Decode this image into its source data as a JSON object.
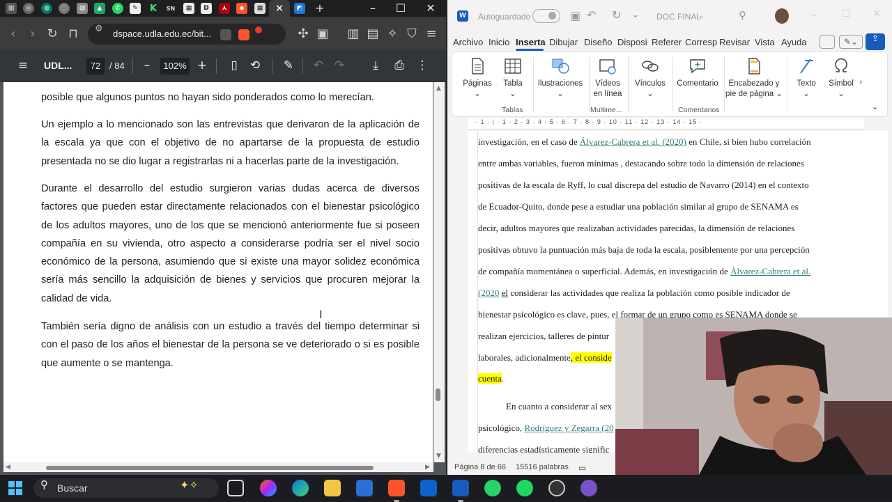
{
  "browser": {
    "address": "dspace.udla.edu.ec/bit...",
    "pdf_title": "UDL...",
    "page_current": "72",
    "page_total": "/ 84",
    "zoom": "102%",
    "paragraphs": [
      "posible que algunos puntos no hayan sido ponderados como lo merecían.",
      "Un ejemplo a lo mencionado son las entrevistas que derivaron de la aplicación de la escala ya que con el objetivo de no apartarse de la propuesta de estudio presentada no se dio lugar a registrarlas ni a hacerlas parte de la investigación.",
      "Durante el desarrollo del estudio surgieron varias dudas acerca de diversos factores que pueden estar directamente relacionados con el bienestar psicológico de los adultos mayores, uno de los que se mencionó anteriormente fue si poseen compañía en su vivienda, otro aspecto a considerarse podría ser el nivel socio económico de la persona, asumiendo que si existe una mayor solidez económica sería más sencillo la adquisición de bienes y servicios que procuren mejorar la calidad de vida.",
      "También sería digno de análisis con un estudio a través del tiempo determinar si con el paso de los años el bienestar de la persona se ve deteriorado o si es posible que aumente o se mantenga."
    ]
  },
  "word": {
    "autosave_label": "Autoguardado",
    "doc_title": "DOC FINAL",
    "tabs": [
      "Archivo",
      "Inicio",
      "Inserta",
      "Dibujar",
      "Diseño",
      "Disposi",
      "Referer",
      "Corresp",
      "Revisar",
      "Vista",
      "Ayuda"
    ],
    "ribbon": {
      "paginas": "Páginas",
      "tabla": "Tabla",
      "ilustraciones": "Ilustraciones",
      "videos_1": "Vídeos",
      "videos_2": "en línea",
      "vinculos": "Vínculos",
      "comentario": "Comentario",
      "encabezado_1": "Encabezado y",
      "encabezado_2": "pie de página",
      "texto": "Texto",
      "simbolos": "Símbol",
      "group_tablas": "Tablas",
      "group_multimedia": "Multime...",
      "group_comentarios": "Comentarios"
    },
    "ruler": "· 1 · | · 1 · 2 · 3 · 4 · 5 · 6 · 7 · 8 · 9 · 10 · 11 · 12 · 13 · 14 · 15 ·",
    "doc": {
      "l1_a": "investigación, en el caso de ",
      "l1_cite": "Álvarez-Cabrera et al. (2020)",
      "l1_b": " en Chile, si bien hubo correlación",
      "l2": "entre ambas variables, fueron mínimas , destacando sobre todo la dimensión de relaciones",
      "l3": "positivas de la escala de Ryff, lo cual discrepa del estudio de Navarro (2014) en el contexto",
      "l4": "de Ecuador-Quito, donde pese a estudiar una población similar al grupo de SENAMA es",
      "l5": "decir, adultos mayores que realizaban actividades parecidas, la dimensión de relaciones",
      "l6": "positivas obtuvo la puntuación más baja de toda la escala, posiblemente por una percepción",
      "l7_a": "de compañía momentánea o superficial. Además, en investigación de ",
      "l7_cite": "Álvarez-Cabrera et al.",
      "l8_cite": "(2020",
      "l8_el": "el",
      "l8_b": " considerar las actividades que realiza la población como posible indicador de",
      "l9": "bienestar psicológico es clave, pues, el formar de un grupo como es SENAMA donde se",
      "l10": "realizan ejercicios, talleres de pintur",
      "l11_a": "laborales, adicionalmente",
      "l11_hl": ", el conside",
      "l12_hl": "cuenta",
      "l12_b": ".",
      "l13": "En cuanto a considerar al sex",
      "l14_a": "psicológico, ",
      "l14_cite": "Rodríguez y Zegarra (20",
      "l15": "diferencias estadísticamente signific"
    },
    "status_page": "Página 8 de 66",
    "status_words": "15516 palabras"
  },
  "taskbar": {
    "search_placeholder": "Buscar"
  },
  "colors": {
    "word_blue": "#185abd",
    "brave_orange": "#fb542b",
    "highlight": "#ffff00",
    "citation": "#2e7d7d"
  }
}
